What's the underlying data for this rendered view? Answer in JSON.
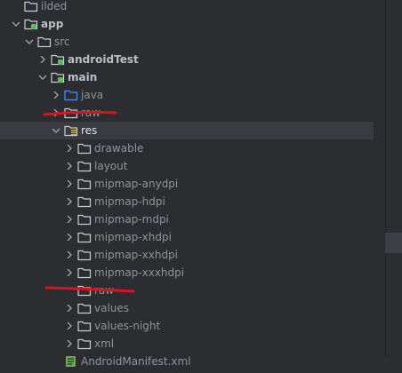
{
  "tree": [
    {
      "label": "ilded",
      "depth": 1,
      "icon": "folder-icon",
      "expanded": false,
      "chevron": "none"
    },
    {
      "label": "app",
      "depth": 1,
      "icon": "module-folder-icon",
      "chevron": "down",
      "bold": true
    },
    {
      "label": "src",
      "depth": 2,
      "icon": "folder-icon",
      "chevron": "down"
    },
    {
      "label": "androidTest",
      "depth": 3,
      "icon": "module-folder-icon",
      "chevron": "right",
      "bold": true
    },
    {
      "label": "main",
      "depth": 3,
      "icon": "module-folder-icon",
      "chevron": "down",
      "bold": true
    },
    {
      "label": "java",
      "depth": 4,
      "icon": "source-folder-icon",
      "chevron": "right"
    },
    {
      "label": "raw",
      "depth": 4,
      "icon": "folder-icon",
      "chevron": "right"
    },
    {
      "label": "res",
      "depth": 4,
      "icon": "resource-folder-icon",
      "chevron": "down",
      "selected": true
    },
    {
      "label": "drawable",
      "depth": 5,
      "icon": "folder-icon",
      "chevron": "right"
    },
    {
      "label": "layout",
      "depth": 5,
      "icon": "folder-icon",
      "chevron": "right"
    },
    {
      "label": "mipmap-anydpi",
      "depth": 5,
      "icon": "folder-icon",
      "chevron": "right"
    },
    {
      "label": "mipmap-hdpi",
      "depth": 5,
      "icon": "folder-icon",
      "chevron": "right"
    },
    {
      "label": "mipmap-mdpi",
      "depth": 5,
      "icon": "folder-icon",
      "chevron": "right"
    },
    {
      "label": "mipmap-xhdpi",
      "depth": 5,
      "icon": "folder-icon",
      "chevron": "right"
    },
    {
      "label": "mipmap-xxhdpi",
      "depth": 5,
      "icon": "folder-icon",
      "chevron": "right"
    },
    {
      "label": "mipmap-xxxhdpi",
      "depth": 5,
      "icon": "folder-icon",
      "chevron": "right"
    },
    {
      "label": "raw",
      "depth": 5,
      "icon": "folder-icon",
      "chevron": "none"
    },
    {
      "label": "values",
      "depth": 5,
      "icon": "folder-icon",
      "chevron": "right"
    },
    {
      "label": "values-night",
      "depth": 5,
      "icon": "folder-icon",
      "chevron": "right"
    },
    {
      "label": "xml",
      "depth": 5,
      "icon": "folder-icon",
      "chevron": "right"
    },
    {
      "label": "AndroidManifest.xml",
      "depth": 4,
      "icon": "manifest-file-icon",
      "chevron": "none"
    }
  ],
  "colors": {
    "background": "#2b2d30",
    "selection": "#393b40",
    "annotation_red": "#e0101c",
    "folder_outline": "#c9cbd1",
    "source_folder": "#548af7",
    "module_dot": "#5fb865"
  }
}
